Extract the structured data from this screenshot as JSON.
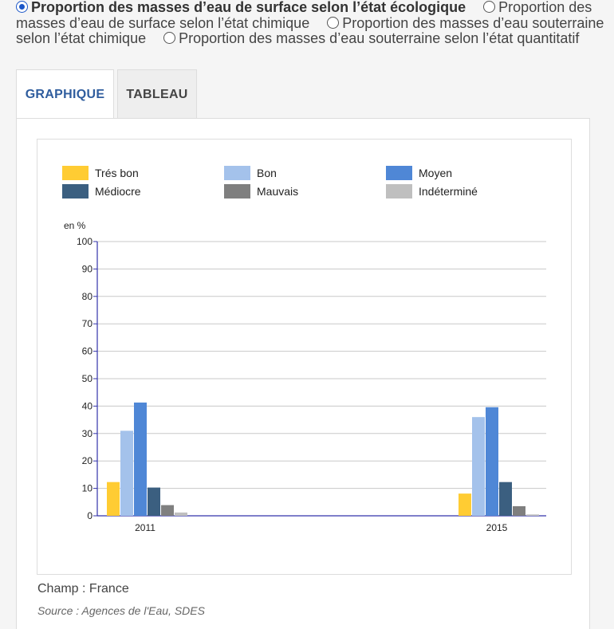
{
  "options": [
    {
      "label": "Proportion des masses d’eau de surface selon l’état écologique",
      "checked": true
    },
    {
      "label": "Proportion des masses d’eau de surface selon l’état chimique",
      "checked": false
    },
    {
      "label": "Proportion des masses d’eau souterraine selon l’état chimique",
      "checked": false
    },
    {
      "label": "Proportion des masses d’eau souterraine selon l’état quantitatif",
      "checked": false
    }
  ],
  "tabs": {
    "graph": "GRAPHIQUE",
    "table": "TABLEAU"
  },
  "note": "Champ : France",
  "source": "Source : Agences de l'Eau, SDES",
  "colors": {
    "Trés bon": "#ffcc33",
    "Bon": "#a4c2eb",
    "Moyen": "#4f87d6",
    "Médiocre": "#3b5f80",
    "Mauvais": "#7f7f7f",
    "Indéterminé": "#bfbfbf",
    "axis": "#3333aa"
  },
  "chart_data": {
    "type": "bar",
    "ylabel": "en %",
    "ylim": [
      0,
      100
    ],
    "yticks": [
      0,
      10,
      20,
      30,
      40,
      50,
      60,
      70,
      80,
      90,
      100
    ],
    "grid": true,
    "legend": "top",
    "categories": [
      "2011",
      "2015"
    ],
    "series": [
      {
        "name": "Trés bon",
        "values": [
          12.3,
          8.1
        ]
      },
      {
        "name": "Bon",
        "values": [
          31.0,
          36.0
        ]
      },
      {
        "name": "Moyen",
        "values": [
          41.3,
          39.6
        ]
      },
      {
        "name": "Médiocre",
        "values": [
          10.3,
          12.3
        ]
      },
      {
        "name": "Mauvais",
        "values": [
          3.9,
          3.5
        ]
      },
      {
        "name": "Indéterminé",
        "values": [
          1.2,
          0.5
        ]
      }
    ]
  }
}
